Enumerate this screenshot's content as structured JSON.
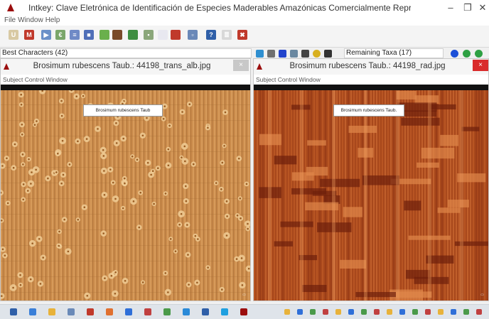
{
  "window": {
    "title": "Intkey: Clave Eletrónica de Identificación de Especies Maderables Amazónicas Comercialmente Representativas",
    "minimize": "–",
    "maximize": "❐",
    "close": "✕"
  },
  "menu": [
    "File",
    "Window",
    "Help"
  ],
  "toolbar": {
    "buttons": [
      {
        "icon": "use-icon",
        "glyph": "U",
        "color": "#d8c9a3"
      },
      {
        "icon": "multistate-icon",
        "glyph": "M",
        "color": "#c0392b"
      },
      {
        "icon": "play-icon",
        "glyph": "▶",
        "color": "#6a90c8"
      },
      {
        "icon": "numeric-icon",
        "glyph": "€",
        "color": "#7aa66a"
      },
      {
        "icon": "list-icon",
        "glyph": "≡",
        "color": "#6f8ac6"
      },
      {
        "icon": "grid-icon",
        "glyph": "■",
        "color": "#4f6fb8"
      },
      {
        "icon": "leaf-icon",
        "glyph": "",
        "color": "#6ab04c"
      },
      {
        "icon": "tree-icon",
        "glyph": "",
        "color": "#7a4a2a"
      },
      {
        "icon": "plant-icon",
        "glyph": "",
        "color": "#3e8e41"
      },
      {
        "icon": "image-icon",
        "glyph": "▪",
        "color": "#8aa67a"
      },
      {
        "icon": "document-icon",
        "glyph": "",
        "color": "#e8e8f0"
      },
      {
        "icon": "red-document-icon",
        "glyph": "",
        "color": "#c0392b"
      },
      {
        "icon": "picture-icon",
        "glyph": "▫",
        "color": "#6a88b8"
      },
      {
        "icon": "help-icon",
        "glyph": "?",
        "color": "#2f5fa8"
      },
      {
        "icon": "notes-icon",
        "glyph": "≣",
        "color": "#d8d8d8"
      },
      {
        "icon": "restart-icon",
        "glyph": "✖",
        "color": "#c0392b"
      }
    ]
  },
  "left_header": {
    "label": "Best Characters (42)"
  },
  "right_header": {
    "label": "Remaining Taxa (17)"
  },
  "mid_icons": [
    "undo-icon",
    "list-icon",
    "square-icon",
    "filter-icon",
    "wave-icon",
    "info-icon",
    "binoculars-icon"
  ],
  "right_icons": [
    "info-icon",
    "check-icon",
    "status-icon"
  ],
  "left_image": {
    "title": "Brosimum rubescens Taub.: 44198_trans_alb.jpg",
    "menu": [
      "Subject",
      "Control",
      "Window"
    ],
    "label": "Brosimum rubescens Taub",
    "close": "×"
  },
  "right_image": {
    "title": "Brosimum rubescens Taub.: 44198_rad.jpg",
    "menu": [
      "Subject",
      "Control",
      "Window"
    ],
    "label": "Brosimum rubescens Taub.",
    "close": "×"
  },
  "colors": {
    "accent_red": "#9b0e0e",
    "left_wood": "#c98a4a",
    "right_wood": "#a8481c"
  },
  "taskbar": {
    "icons": [
      "start-icon",
      "ie-icon",
      "folder-icon",
      "explorer-icon",
      "red-app-icon",
      "orange-app-icon",
      "blue-app-icon",
      "pen-app-icon",
      "chrome-icon",
      "media-icon",
      "word-icon",
      "skype-icon",
      "intkey-icon"
    ]
  }
}
